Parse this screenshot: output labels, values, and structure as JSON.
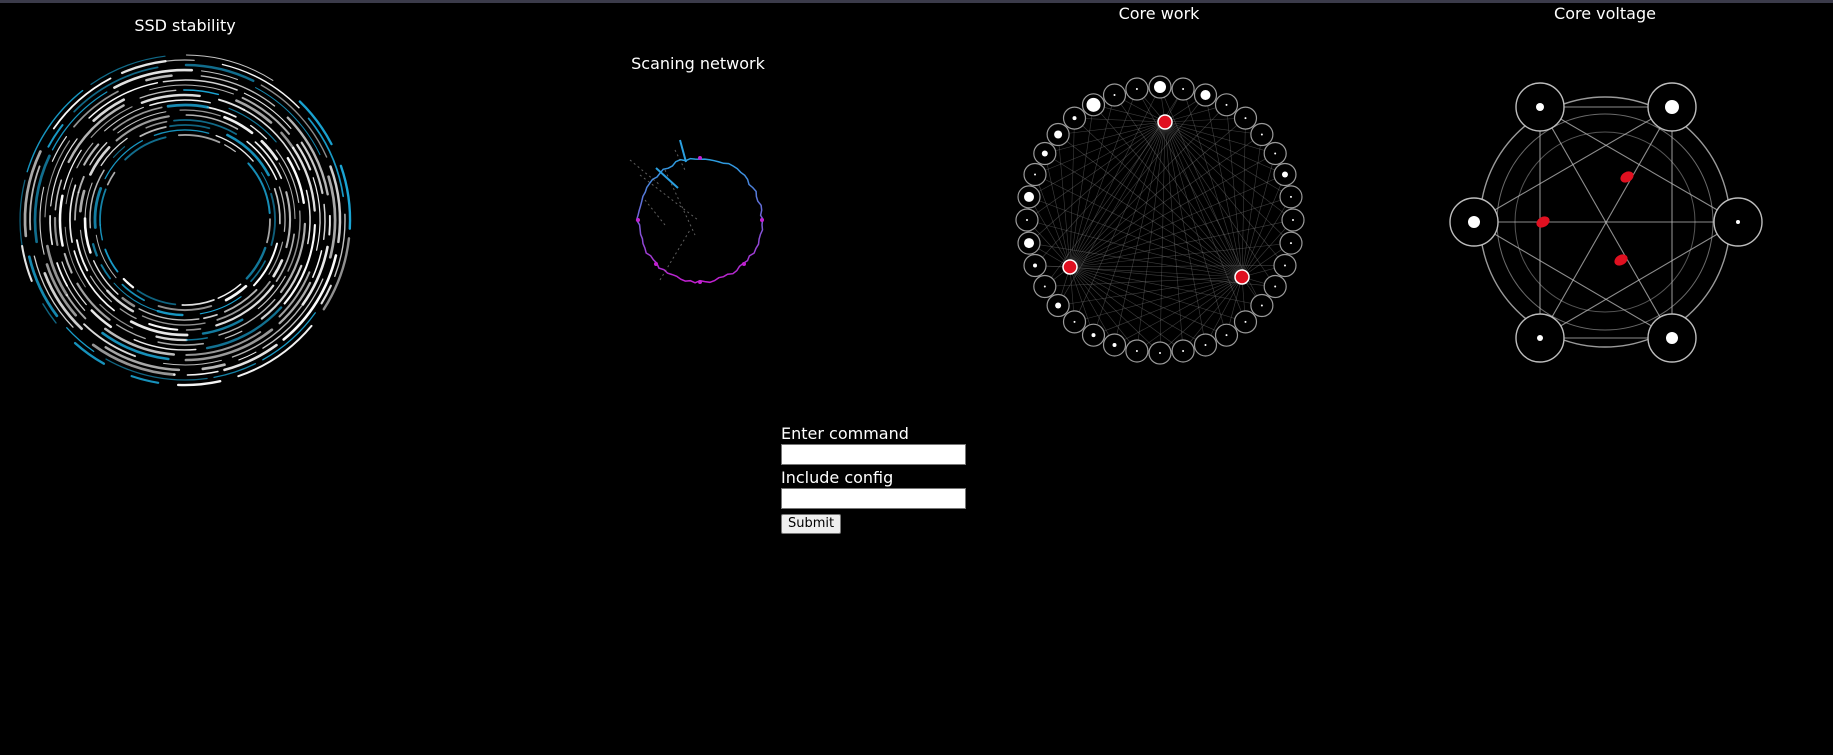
{
  "panels": {
    "ssd": {
      "title": "SSD stability"
    },
    "network": {
      "title": "Scaning network"
    },
    "core_work": {
      "title": "Core work"
    },
    "core_voltage": {
      "title": "Core voltage"
    }
  },
  "form": {
    "command_label": "Enter command",
    "command_value": "",
    "config_label": "Include config",
    "config_value": "",
    "submit_label": "Submit"
  },
  "colors": {
    "background": "#000000",
    "ring_white": "#ffffff",
    "ring_cyan": "#1aa6d6",
    "network_blue": "#2a9fe0",
    "network_magenta": "#c21fd0",
    "node_red": "#e01020",
    "edge_gray": "#8a8a8a"
  }
}
